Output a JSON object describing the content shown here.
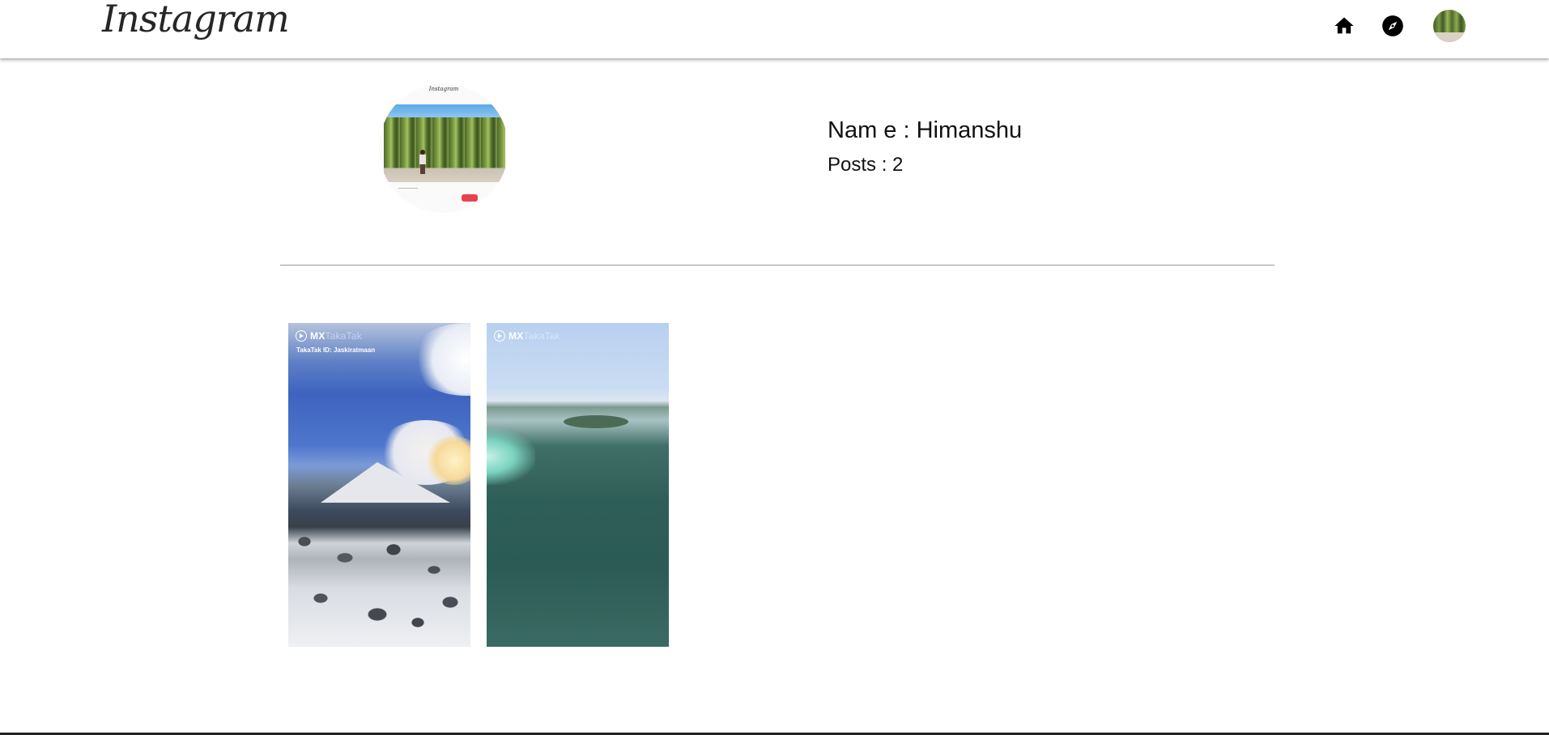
{
  "header": {
    "logo_text": "Instagram",
    "icons": [
      "home-icon",
      "explore-icon",
      "avatar"
    ]
  },
  "profile": {
    "name_line": "Nam e : Himanshu",
    "posts_line": "Posts : 2",
    "pic_title": "Instagram"
  },
  "posts": [
    {
      "watermark_main": "MX",
      "watermark_dim": "TakaTak",
      "caption": "TakaTak ID: Jaskiratmaan"
    },
    {
      "watermark_main": "MX",
      "watermark_dim": "TakaTak",
      "caption": ""
    }
  ]
}
